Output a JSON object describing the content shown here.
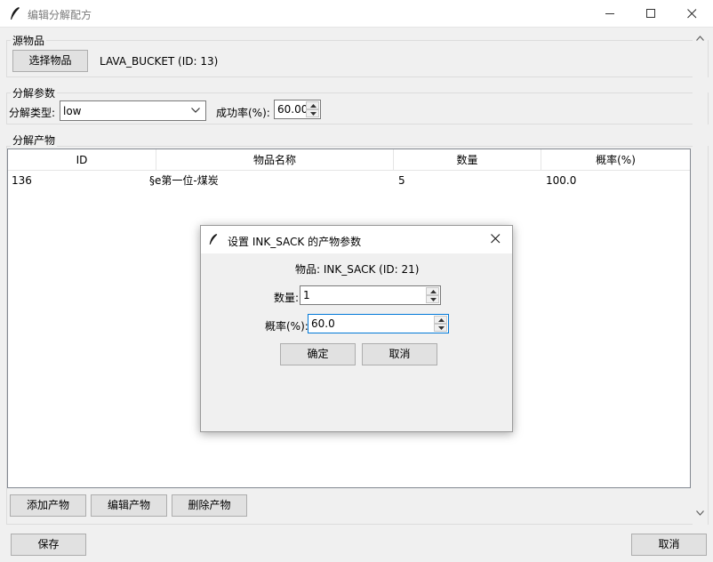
{
  "window": {
    "title": "编辑分解配方"
  },
  "source": {
    "group_label": "源物品",
    "select_button": "选择物品",
    "selected_text": "LAVA_BUCKET (ID: 13)"
  },
  "params": {
    "group_label": "分解参数",
    "type_label": "分解类型:",
    "type_value": "low",
    "rate_label": "成功率(%):",
    "rate_value": "60.00"
  },
  "products": {
    "group_label": "分解产物",
    "columns": [
      "ID",
      "物品名称",
      "数量",
      "概率(%)"
    ],
    "rows": [
      [
        "136",
        "§e第一位-煤炭",
        "5",
        "100.0"
      ]
    ],
    "add_button": "添加产物",
    "edit_button": "编辑产物",
    "delete_button": "删除产物"
  },
  "footer": {
    "save_button": "保存",
    "cancel_button": "取消"
  },
  "dialog": {
    "title": "设置 INK_SACK 的产物参数",
    "item_text": "物品: INK_SACK (ID: 21)",
    "quantity_label": "数量:",
    "quantity_value": "1",
    "prob_label": "概率(%):",
    "prob_value": "60.0",
    "ok_button": "确定",
    "cancel_button": "取消"
  },
  "colors": {
    "focus_border": "#0078d7",
    "title_text": "#7a7a7a"
  }
}
